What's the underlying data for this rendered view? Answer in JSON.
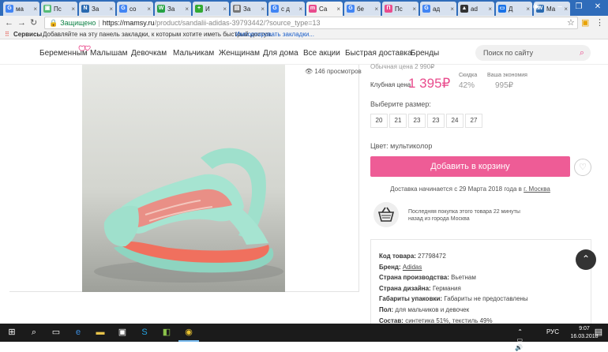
{
  "browser": {
    "tabs": [
      {
        "label": "ма",
        "fav": "G",
        "color": "#4285f4"
      },
      {
        "label": "Пс",
        "fav": "▣",
        "color": "#5b7"
      },
      {
        "label": "За",
        "fav": "N",
        "color": "#2a6ab0"
      },
      {
        "label": "co",
        "fav": "G",
        "color": "#4285f4"
      },
      {
        "label": "За",
        "fav": "W",
        "color": "#25a244"
      },
      {
        "label": "И",
        "fav": "+",
        "color": "#3a3"
      },
      {
        "label": "За",
        "fav": "▤",
        "color": "#777"
      },
      {
        "label": "с д",
        "fav": "G",
        "color": "#4285f4"
      },
      {
        "label": "Са",
        "fav": "m",
        "color": "#e94c8d"
      },
      {
        "label": "бе",
        "fav": "G",
        "color": "#4285f4"
      },
      {
        "label": "Пс",
        "fav": "П",
        "color": "#e94c8d"
      },
      {
        "label": "ад",
        "fav": "G",
        "color": "#4285f4"
      },
      {
        "label": "ad",
        "fav": "▲",
        "color": "#333"
      },
      {
        "label": "Д",
        "fav": "▭",
        "color": "#1a73e8"
      },
      {
        "label": "Ма",
        "fav": "W",
        "color": "#2a6ab0"
      }
    ],
    "active_tab": 8,
    "close_glyph": "×",
    "url_secure": "Защищено",
    "url_host": "https://mamsy.ru",
    "url_path": "/product/sandalii-adidas-39793442/?source_type=13",
    "bookmarks_label": "Сервисы",
    "bookmarks_hint": "Добавляйте на эту панель закладки, к которым хотите иметь быстрый доступ.",
    "bookmarks_link": "Импортировать закладки..."
  },
  "nav": {
    "items": [
      "Беременным",
      "Малышам",
      "Девочкам",
      "Мальчикам",
      "Женщинам",
      "Для дома",
      "Все акции",
      "Быстрая доставка",
      "Бренды"
    ],
    "search_placeholder": "Поиск по сайту"
  },
  "product": {
    "views": "146 просмотров",
    "regular_price_label": "Обычная цена 2 990₽",
    "club_price_label": "Клубная цена",
    "club_price": "1 395₽",
    "discount_label": "Скидка",
    "discount": "42%",
    "savings_label": "Ваша экономия",
    "savings": "995₽",
    "size_label": "Выберите размер:",
    "sizes": [
      "20",
      "21",
      "23",
      "23",
      "24",
      "27"
    ],
    "color": "Цвет: мультиколор",
    "add_to_cart": "Добавить в корзину",
    "delivery_text": "Доставка начинается с 29 Марта 2018 года в",
    "delivery_city": "г. Москва",
    "recent_purchase": "Последняя покупка этого товара 22 минуты назад из города Москва",
    "details": [
      {
        "key": "Код товара:",
        "value": "27798472",
        "link": false
      },
      {
        "key": "Бренд:",
        "value": "Adidas",
        "link": true
      },
      {
        "key": "Страна производства:",
        "value": "Вьетнам",
        "link": false
      },
      {
        "key": "Страна дизайна:",
        "value": "Германия",
        "link": false
      },
      {
        "key": "Габариты упаковки:",
        "value": "Габариты не предоставлены",
        "link": false
      },
      {
        "key": "Пол:",
        "value": "для мальчиков и девочек",
        "link": false
      },
      {
        "key": "Состав:",
        "value": "синтетика 51%, текстиль 49%",
        "link": false
      }
    ]
  },
  "taskbar": {
    "lang": "РУС",
    "time": "9:07",
    "date": "16.03.2018"
  },
  "colors": {
    "accent": "#ee5c96",
    "price": "#e94c8d",
    "chrome_blue": "#2f6cba"
  }
}
